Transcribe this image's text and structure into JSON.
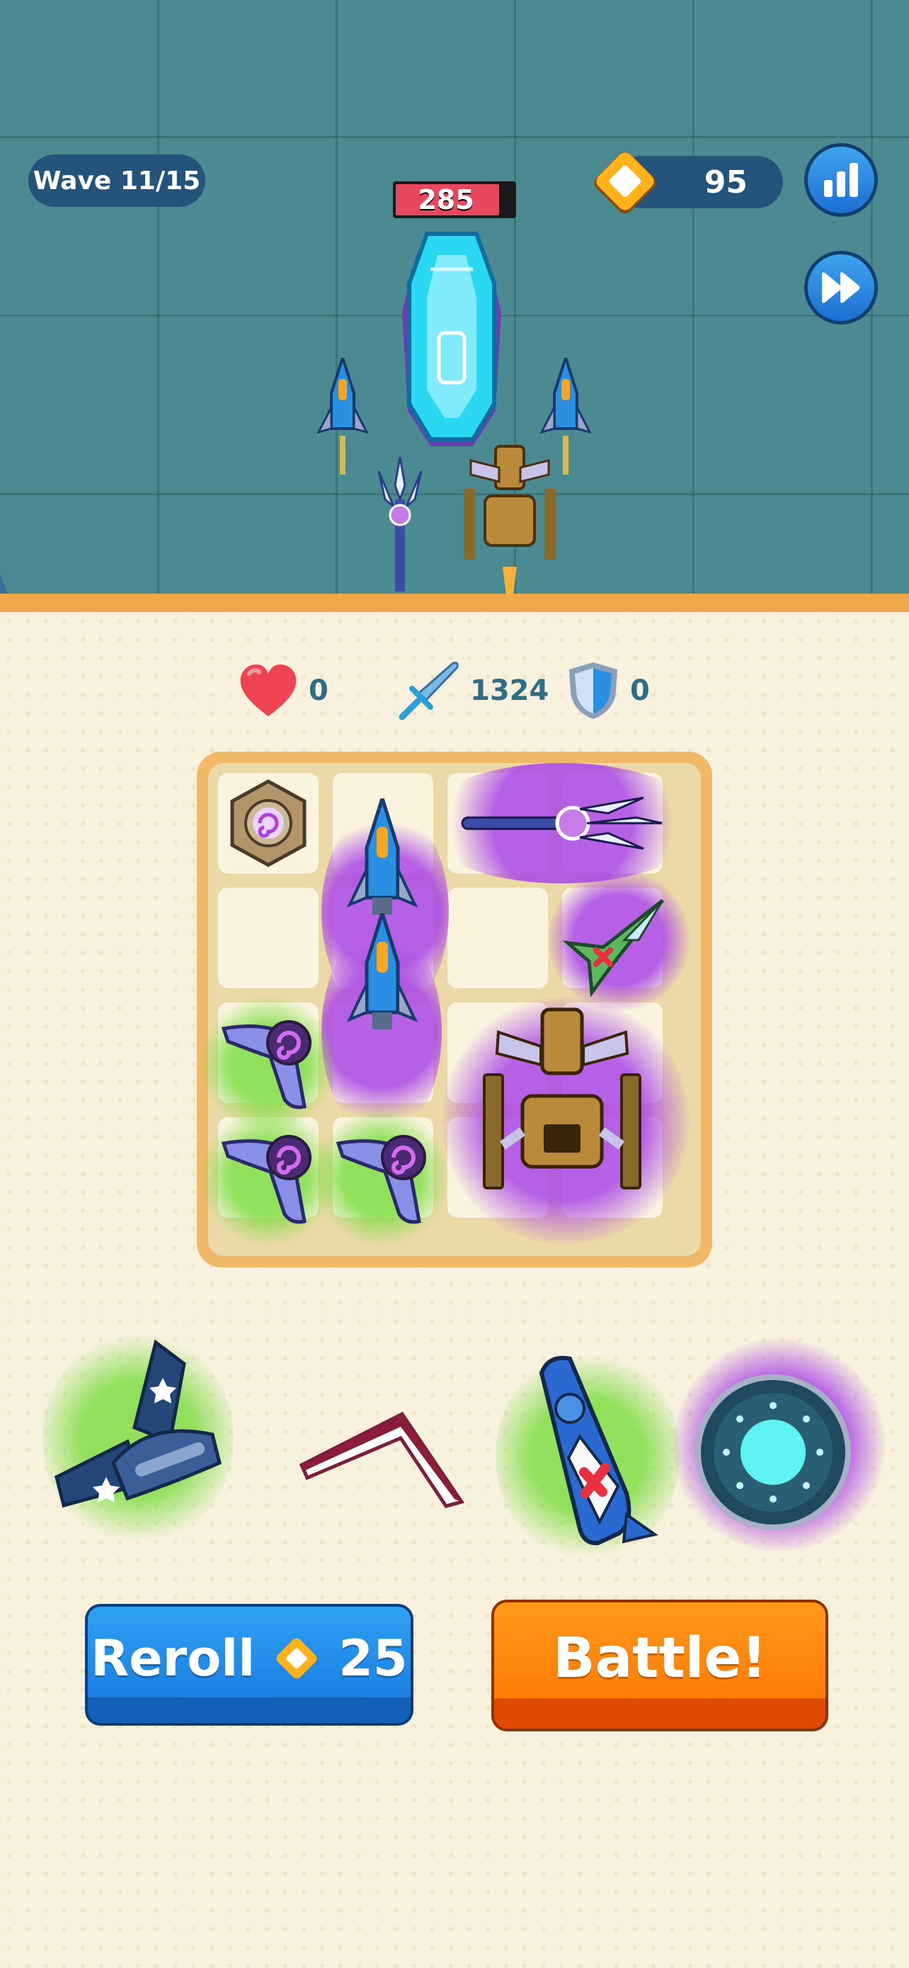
{
  "hud": {
    "wave_label": "Wave 11/15",
    "coins": "95",
    "stats_icon": "bar-chart-icon",
    "fast_forward_icon": "fast-forward-icon"
  },
  "boss": {
    "hp": "285",
    "hp_fraction": 0.88
  },
  "stats": {
    "health": "0",
    "attack": "1324",
    "defense": "0"
  },
  "grid": {
    "rows": 4,
    "cols": 4,
    "items": [
      {
        "name": "hex-core-module",
        "rarity": "purple"
      },
      {
        "name": "blue-fighter",
        "rarity": "purple"
      },
      {
        "name": "trident-missile",
        "rarity": "purple"
      },
      {
        "name": "green-jet",
        "rarity": "purple"
      },
      {
        "name": "blue-fighter",
        "rarity": "purple"
      },
      {
        "name": "purple-boomerang",
        "rarity": "green"
      },
      {
        "name": "purple-boomerang",
        "rarity": "green"
      },
      {
        "name": "purple-boomerang",
        "rarity": "green"
      },
      {
        "name": "bronze-mech-ship",
        "rarity": "purple"
      }
    ]
  },
  "shop": {
    "items": [
      {
        "name": "star-plane",
        "rarity": "green"
      },
      {
        "name": "red-boomerang",
        "rarity": "none"
      },
      {
        "name": "medic-ship",
        "rarity": "green"
      },
      {
        "name": "energy-orb",
        "rarity": "purple"
      }
    ]
  },
  "buttons": {
    "reroll_label": "Reroll",
    "reroll_cost": "25",
    "battle_label": "Battle!"
  },
  "colors": {
    "battlefield": "#4c8a92",
    "board": "#f8f1de",
    "rare_glow_purple": "#aa46e6",
    "rare_glow_green": "#78dc3c",
    "reroll": "#1b80e2",
    "battle": "#ff7b07"
  }
}
